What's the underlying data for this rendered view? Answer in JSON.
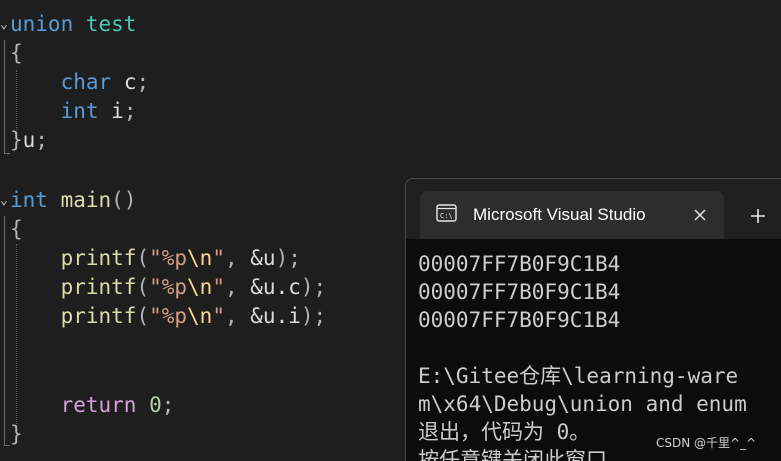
{
  "editor": {
    "union_keyword": "union",
    "union_name": "test",
    "member_char_type": "char",
    "member_char_name": "c",
    "member_int_type": "int",
    "member_int_name": "i",
    "union_var": "u",
    "main_return_type": "int",
    "main_name": "main",
    "printf_name": "printf",
    "format_string": "\"%p",
    "format_escape": "\\n",
    "format_quote_end": "\"",
    "arg_u": "&u",
    "arg_uc": "&u.c",
    "arg_ui": "&u.i",
    "return_keyword": "return",
    "return_value": "0"
  },
  "terminal": {
    "tab_title": "Microsoft Visual Studio",
    "lines": [
      "00007FF7B0F9C1B4",
      "00007FF7B0F9C1B4",
      "00007FF7B0F9C1B4",
      "",
      "E:\\Gitee仓库\\learning-ware",
      "m\\x64\\Debug\\union and enum",
      "退出，代码为 0。",
      "按任意键关闭此窗口"
    ]
  },
  "watermark": "CSDN @千里^_^",
  "colors": {
    "editor_bg": "#1e1e1e",
    "keyword": "#569cd6",
    "control_keyword": "#d8a0df",
    "type_name": "#4ec9b0",
    "function": "#dcdcaa",
    "string": "#d69d85",
    "escape": "#ffd68f",
    "number": "#b5cea8",
    "terminal_bg": "#0c0c0c"
  }
}
